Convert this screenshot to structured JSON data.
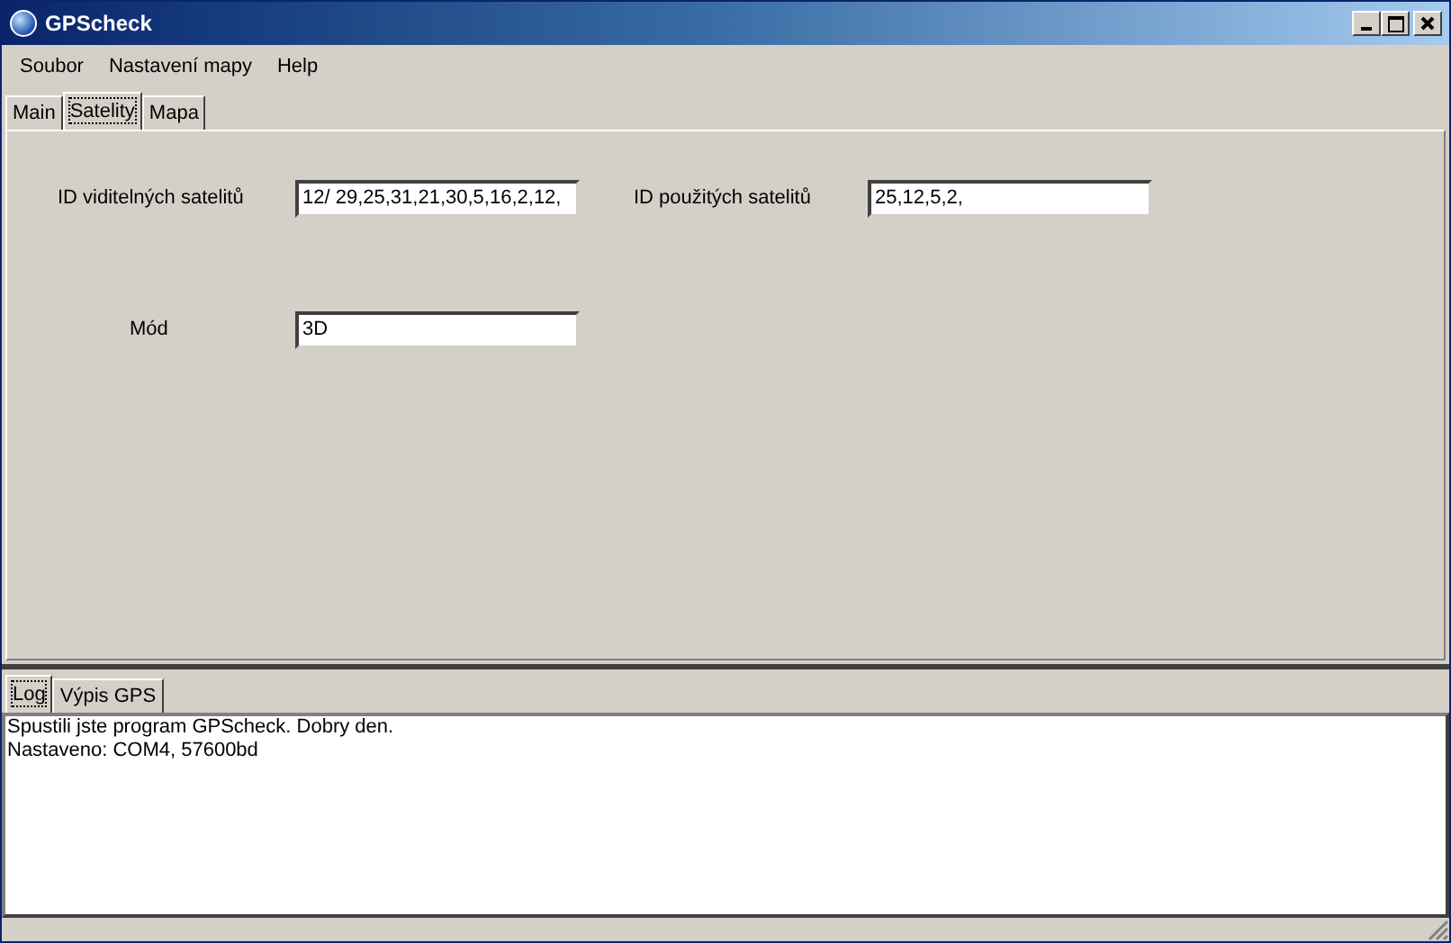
{
  "window": {
    "title": "GPScheck"
  },
  "menu": [
    "Soubor",
    "Nastavení mapy",
    "Help"
  ],
  "tabs": [
    {
      "label": "Main",
      "selected": false
    },
    {
      "label": "Satelity",
      "selected": true
    },
    {
      "label": "Mapa",
      "selected": false
    }
  ],
  "fields": [
    {
      "label": "ID viditelných satelitů",
      "value": "12/ 29,25,31,21,30,5,16,2,12,"
    },
    {
      "label": "ID použitých satelitů",
      "value": "25,12,5,2,"
    },
    {
      "label": "Mód",
      "value": "3D"
    }
  ],
  "log_tabs": [
    {
      "label": "Log",
      "selected": true
    },
    {
      "label": "Výpis GPS",
      "selected": false
    }
  ],
  "log_lines": [
    "Spustili jste program GPScheck. Dobry den.",
    "Nastaveno: COM4, 57600bd"
  ]
}
